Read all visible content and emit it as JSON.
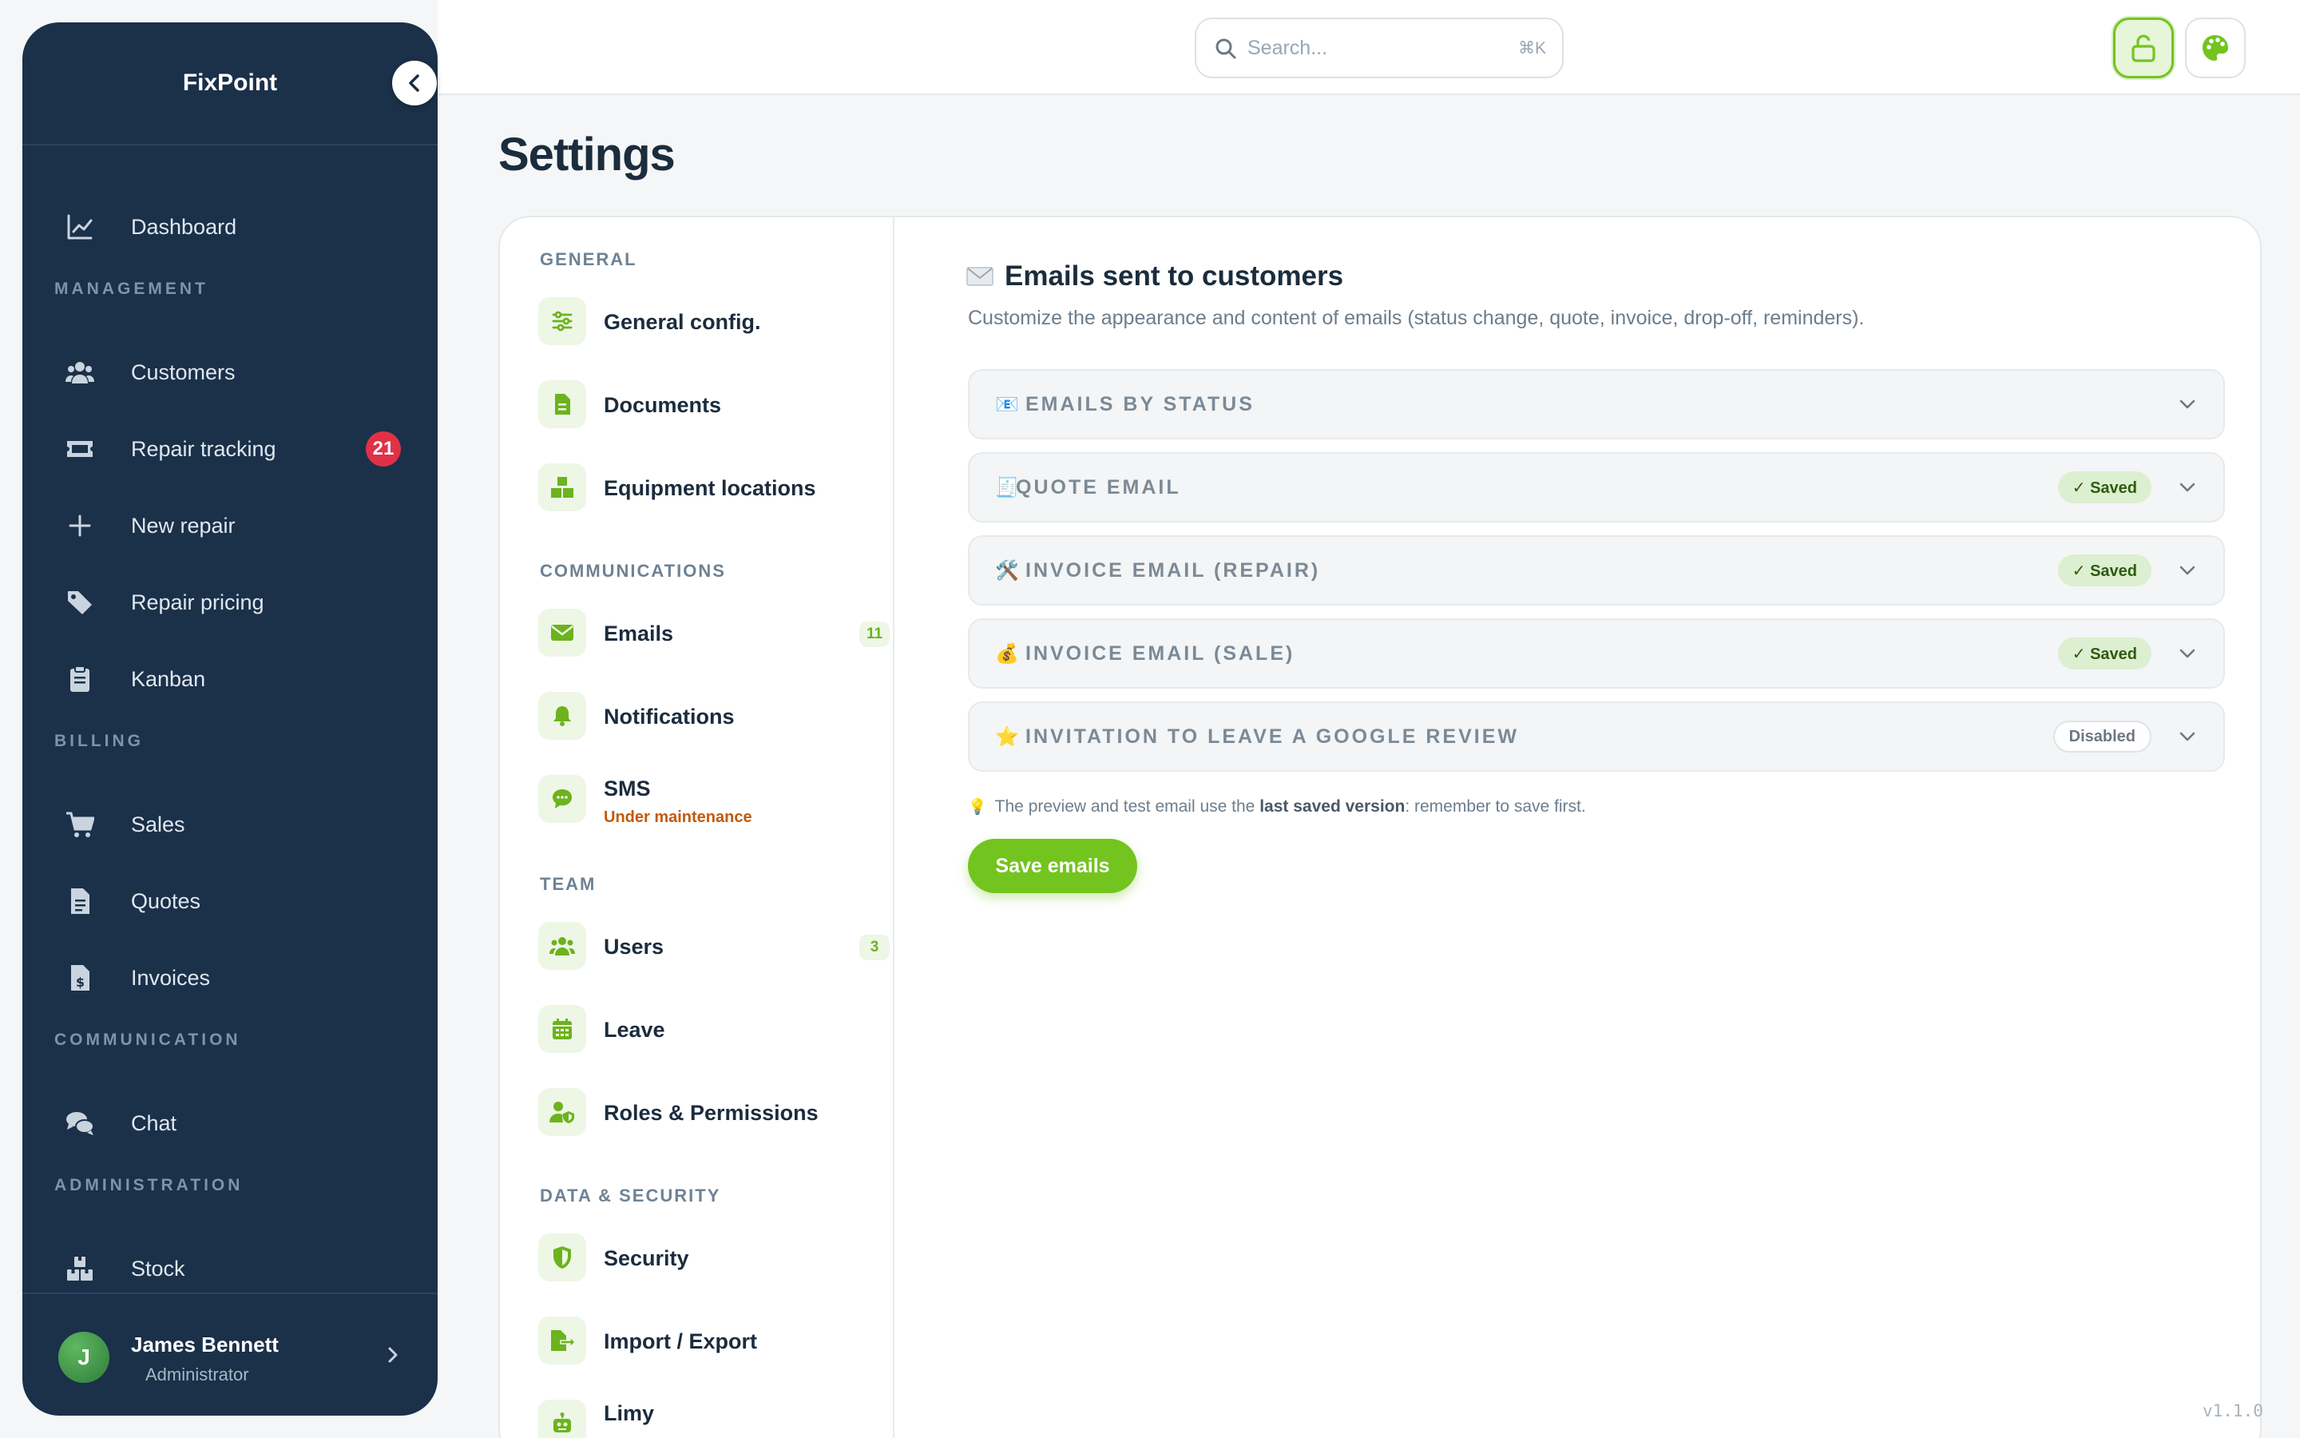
{
  "app": {
    "brand": "FixPoint",
    "version": "v1.1.0"
  },
  "search": {
    "placeholder": "Search...",
    "shortcut": "⌘K"
  },
  "colors": {
    "accent": "#74c41f",
    "sidebar": "#1b3049",
    "badge": "#e03147",
    "warning": "#c35a0a"
  },
  "sidebar": {
    "items": [
      {
        "label": "Dashboard",
        "icon": "chart-line-icon"
      },
      {
        "section": "MANAGEMENT"
      },
      {
        "label": "Customers",
        "icon": "users-icon"
      },
      {
        "label": "Repair tracking",
        "icon": "ticket-icon",
        "badge": "21"
      },
      {
        "label": "New repair",
        "icon": "plus-icon"
      },
      {
        "label": "Repair pricing",
        "icon": "tags-icon"
      },
      {
        "label": "Kanban",
        "icon": "clipboard-icon"
      },
      {
        "section": "BILLING"
      },
      {
        "label": "Sales",
        "icon": "cart-icon"
      },
      {
        "label": "Quotes",
        "icon": "file-lines-icon"
      },
      {
        "label": "Invoices",
        "icon": "file-dollar-icon"
      },
      {
        "section": "COMMUNICATION"
      },
      {
        "label": "Chat",
        "icon": "comments-icon"
      },
      {
        "section": "ADMINISTRATION"
      },
      {
        "label": "Stock",
        "icon": "boxes-icon"
      }
    ],
    "user": {
      "initial": "J",
      "name": "James Bennett",
      "role": "Administrator"
    }
  },
  "page": {
    "title": "Settings"
  },
  "settings_nav": {
    "sections": {
      "general": "GENERAL",
      "communications": "COMMUNICATIONS",
      "team": "TEAM",
      "data_security": "DATA & SECURITY"
    },
    "items": {
      "general_config": "General config.",
      "documents": "Documents",
      "equipment_locations": "Equipment locations",
      "emails": "Emails",
      "emails_count": "11",
      "notifications": "Notifications",
      "sms": "SMS",
      "sms_status": "Under maintenance",
      "users": "Users",
      "users_count": "3",
      "leave": "Leave",
      "roles": "Roles & Permissions",
      "security": "Security",
      "import_export": "Import / Export",
      "limy": "Limy"
    }
  },
  "content": {
    "title": "Emails sent to customers",
    "description": "Customize the appearance and content of emails (status change, quote, invoice, drop-off, reminders).",
    "accordions": [
      {
        "icon": "📧",
        "title": "EMAILS BY STATUS",
        "status": ""
      },
      {
        "icon": "🧾",
        "title": "QUOTE EMAIL",
        "status": "✓ Saved"
      },
      {
        "icon": "🛠️",
        "title": "INVOICE EMAIL (REPAIR)",
        "status": "✓ Saved"
      },
      {
        "icon": "💰",
        "title": "INVOICE EMAIL (SALE)",
        "status": "✓ Saved"
      },
      {
        "icon": "⭐",
        "title": "INVITATION TO LEAVE A GOOGLE REVIEW",
        "status": "Disabled"
      }
    ],
    "note": {
      "icon": "💡",
      "before": "The preview and test email use the",
      "bold": "last saved version",
      "after": ": remember to save first."
    },
    "save_label": "Save emails"
  }
}
